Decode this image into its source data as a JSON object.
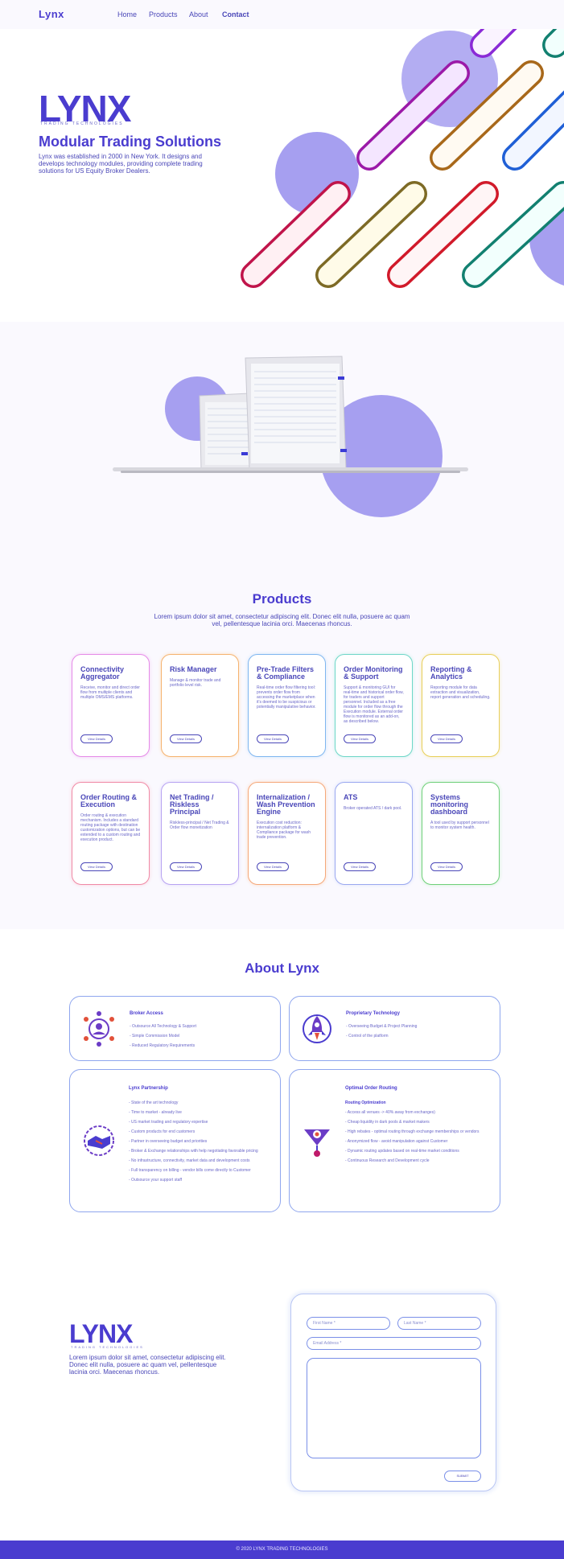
{
  "nav": {
    "logo": "Lynx",
    "items": [
      "Home",
      "Products",
      "About",
      "Contact"
    ]
  },
  "hero": {
    "logo": "LYNX",
    "logo_sub": "TRADING TECHNOLOGIES",
    "title": "Modular Trading Solutions",
    "text": "Lynx was established in 2000 in New York. It designs and develops technology modules, providing complete trading solutions for US Equity Broker Dealers."
  },
  "products": {
    "title": "Products",
    "text": "Lorem ipsum dolor sit amet, consectetur adipiscing elit. Donec elit nulla, posuere ac quam vel, pellentesque lacinia orci. Maecenas rhoncus.",
    "button_label": "View Details",
    "cards": [
      {
        "title": "Connectivity Aggregator",
        "text": "Receive, monitor and direct order flow from multiple clients and multiple OMS/EMS platforms.",
        "color": "#e58ae8"
      },
      {
        "title": "Risk Manager",
        "text": "Manage & monitor trade and portfolio level risk.",
        "color": "#f5b26e"
      },
      {
        "title": "Pre-Trade Filters & Compliance",
        "text": "Real-time order flow filtering tool: prevents order flow from accessing the marketplace when it's deemed to be suspicious or potentially manipulative behavior.",
        "color": "#7fb6f0"
      },
      {
        "title": "Order Monitoring & Support",
        "text": "Support & monitoring GUI for real-time and historical order flow, for traders and support personnel. Included as a free module for order flow through the Execution module. External order flow is monitored as an add-on, as described below.",
        "color": "#6ed6c8"
      },
      {
        "title": "Reporting & Analytics",
        "text": "Reporting module for data extraction and visualization, report generation and scheduling.",
        "color": "#e8cf5a"
      },
      {
        "title": "Order Routing & Execution",
        "text": "Order routing & execution mechanism. Includes a standard routing package with destination customization options, but can be extended to a custom routing and execution product.",
        "color": "#f08aa6"
      },
      {
        "title": "Net Trading / Riskless Principal",
        "text": "Riskless-principal / Net Trading & Order flow monetization",
        "color": "#b7a3f2"
      },
      {
        "title": "Internalization / Wash Prevention Engine",
        "text": "Execution cost reduction: internalization platform & Compliance package for wash trade prevention.",
        "color": "#f5a87a"
      },
      {
        "title": "ATS",
        "text": "Broker operated ATS / dark pool.",
        "color": "#9aa8f0"
      },
      {
        "title": "Systems monitoring dashboard",
        "text": "A tool used by support personnel to monitor system health.",
        "color": "#6fd07a"
      }
    ]
  },
  "about": {
    "title": "About Lynx",
    "boxes": [
      {
        "title": "Broker Access",
        "icon": "people-network-icon",
        "items": [
          "- Outsource All Technology & Support",
          "- Simple Commission Model",
          "- Reduced Regulatory Requirements"
        ]
      },
      {
        "title": "Proprietary Technology",
        "icon": "rocket-icon",
        "items": [
          "- Overseeing Budget & Project Planning",
          "- Control of the platform"
        ]
      },
      {
        "title": "Lynx Partnership",
        "icon": "handshake-icon",
        "items": [
          "- State of the art technology",
          "- Time to market - already live",
          "- US market trading and regulatory expertise",
          "- Custom products for end customers",
          "- Partner in overseeing budget and priorities",
          "- Broker & Exchange relationships with help negotiating favorable pricing",
          "- No infrastructure, connectivity, market data and development costs",
          "- Full transparency on billing - vendor bills come directly to Customer",
          "- Outsource your support staff"
        ]
      },
      {
        "title": "Optimal Order Routing",
        "subtitle": "Routing Optimization",
        "icon": "target-icon",
        "items": [
          "- Access all venues -> 40% away from exchanges)",
          "- Cheap liquidity in dark pools & market makers",
          "- High rebates - optimal routing through exchange memberships or vendors",
          "- Anonymized flow - avoid manipulation against Customer",
          "- Dynamic routing updates based on real-time market conditions",
          "- Continuous Research and Development cycle"
        ]
      }
    ]
  },
  "contact": {
    "logo": "LYNX",
    "logo_sub": "TRADING TECHNOLOGIES",
    "text": "Lorem ipsum dolor sit amet, consectetur adipiscing elit. Donec elit nulla, posuere ac quam vel, pellentesque lacinia orci. Maecenas rhoncus.",
    "first_name_placeholder": "First Name *",
    "last_name_placeholder": "Last Name *",
    "email_placeholder": "Email Address *",
    "submit_label": "SUBMIT"
  },
  "footer": {
    "text": "© 2020 LYNX TRADING TECHNOLOGIES"
  },
  "colors": {
    "brand": "#4a3ccf",
    "accent_circle": "#a69ff0"
  }
}
